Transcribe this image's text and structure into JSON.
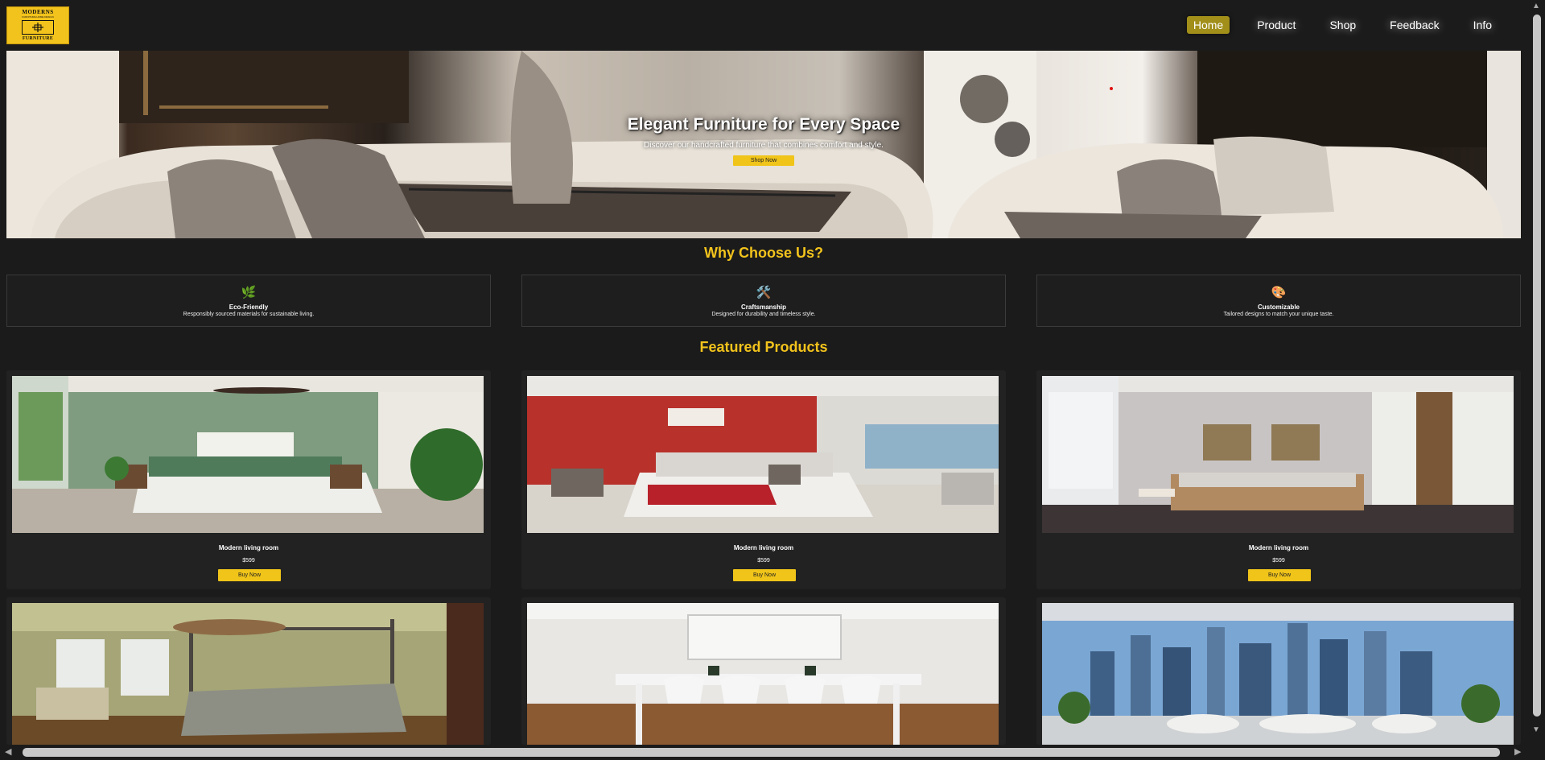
{
  "logo": {
    "line1": "MODERNS",
    "line2": "FURNITURE HOME DESIGN",
    "line3": "FURNITURE"
  },
  "nav": {
    "items": [
      {
        "label": "Home",
        "active": true
      },
      {
        "label": "Product",
        "active": false
      },
      {
        "label": "Shop",
        "active": false
      },
      {
        "label": "Feedback",
        "active": false
      },
      {
        "label": "Info",
        "active": false
      }
    ]
  },
  "hero": {
    "title": "Elegant Furniture for Every Space",
    "subtitle": "Discover our handcrafted furniture that combines comfort and style.",
    "button": "Shop Now"
  },
  "why": {
    "title": "Why Choose Us?",
    "features": [
      {
        "icon": "leaf-icon",
        "glyph": "🌿",
        "title": "Eco-Friendly",
        "desc": "Responsibly sourced materials for sustainable living."
      },
      {
        "icon": "tools-icon",
        "glyph": "🛠️",
        "title": "Craftsmanship",
        "desc": "Designed for durability and timeless style."
      },
      {
        "icon": "palette-icon",
        "glyph": "🎨",
        "title": "Customizable",
        "desc": "Tailored designs to match your unique taste."
      }
    ]
  },
  "featured": {
    "title": "Featured Products",
    "products": [
      {
        "name": "Modern living room",
        "price": "$599",
        "button": "Buy Now",
        "image": "green-bedroom"
      },
      {
        "name": "Modern living room",
        "price": "$599",
        "button": "Buy Now",
        "image": "red-bedroom"
      },
      {
        "name": "Modern living room",
        "price": "$599",
        "button": "Buy Now",
        "image": "grey-bedroom"
      },
      {
        "name": "",
        "price": "",
        "button": "",
        "image": "canopy-bedroom"
      },
      {
        "name": "",
        "price": "",
        "button": "",
        "image": "white-dining-room"
      },
      {
        "name": "",
        "price": "",
        "button": "",
        "image": "city-view-lounge"
      }
    ]
  },
  "colors": {
    "background": "#1b1b1b",
    "accent": "#f2c31c",
    "nav_active": "#a18f1a",
    "card": "#222222"
  }
}
